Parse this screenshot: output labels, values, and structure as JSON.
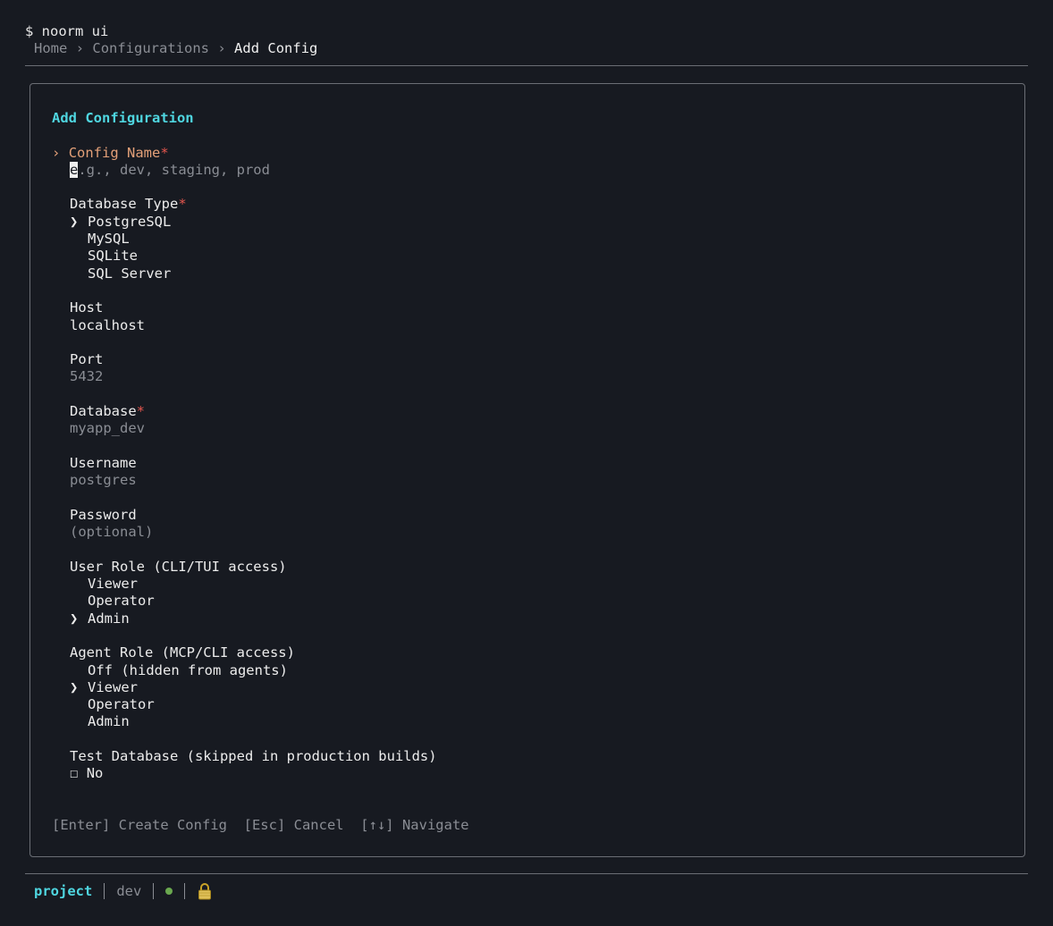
{
  "terminal": {
    "prompt": "$ noorm ui"
  },
  "breadcrumb": {
    "items": [
      "Home",
      "Configurations"
    ],
    "separator": "›",
    "current": "Add Config"
  },
  "form": {
    "title": "Add Configuration",
    "required_marker": "*",
    "active_marker": "›",
    "select_marker": "❯",
    "config_name": {
      "label": "Config Name",
      "cursor_char": "e",
      "placeholder_rest": ".g., dev, staging, prod"
    },
    "database_type": {
      "label": "Database Type",
      "options": [
        "PostgreSQL",
        "MySQL",
        "SQLite",
        "SQL Server"
      ],
      "selected": "PostgreSQL"
    },
    "host": {
      "label": "Host",
      "value": "localhost"
    },
    "port": {
      "label": "Port",
      "placeholder": "5432"
    },
    "database": {
      "label": "Database",
      "placeholder": "myapp_dev"
    },
    "username": {
      "label": "Username",
      "placeholder": "postgres"
    },
    "password": {
      "label": "Password",
      "placeholder": "(optional)"
    },
    "user_role": {
      "label": "User Role (CLI/TUI access)",
      "options": [
        "Viewer",
        "Operator",
        "Admin"
      ],
      "selected": "Admin"
    },
    "agent_role": {
      "label": "Agent Role (MCP/CLI access)",
      "options": [
        "Off (hidden from agents)",
        "Viewer",
        "Operator",
        "Admin"
      ],
      "selected": "Viewer"
    },
    "test_database": {
      "label": "Test Database (skipped in production builds)",
      "checkbox": "☐",
      "value": "No"
    },
    "hints": {
      "enter": "[Enter] Create Config",
      "esc": "[Esc] Cancel",
      "nav": "[↑↓] Navigate"
    }
  },
  "statusbar": {
    "project": "project",
    "env": "dev",
    "dot_color": "#6aa84f",
    "lock": "lock-icon"
  },
  "colors": {
    "accent": "#4fd6e0",
    "active_label": "#e3a078",
    "required": "#e4564e",
    "background": "#171a21",
    "muted": "#8a8d94"
  }
}
